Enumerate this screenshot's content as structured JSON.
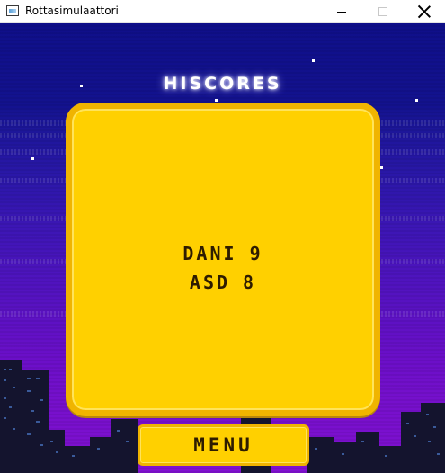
{
  "window": {
    "title": "Rottasimulaattori",
    "icon": "app-window-icon",
    "controls": [
      "minimize-icon",
      "maximize-icon",
      "close-icon"
    ]
  },
  "screen": {
    "heading": "HISCORES",
    "scores": [
      {
        "name": "DANI",
        "score": "9"
      },
      {
        "name": "ASD",
        "score": "8"
      }
    ],
    "menu_label": "MENU"
  },
  "colors": {
    "sky_top": "#0f0f8a",
    "sky_bottom": "#8010d0",
    "panel": "#ffd000",
    "panel_border": "#f0b400",
    "text_dark": "#2e1c00",
    "heading": "#ffffff"
  }
}
